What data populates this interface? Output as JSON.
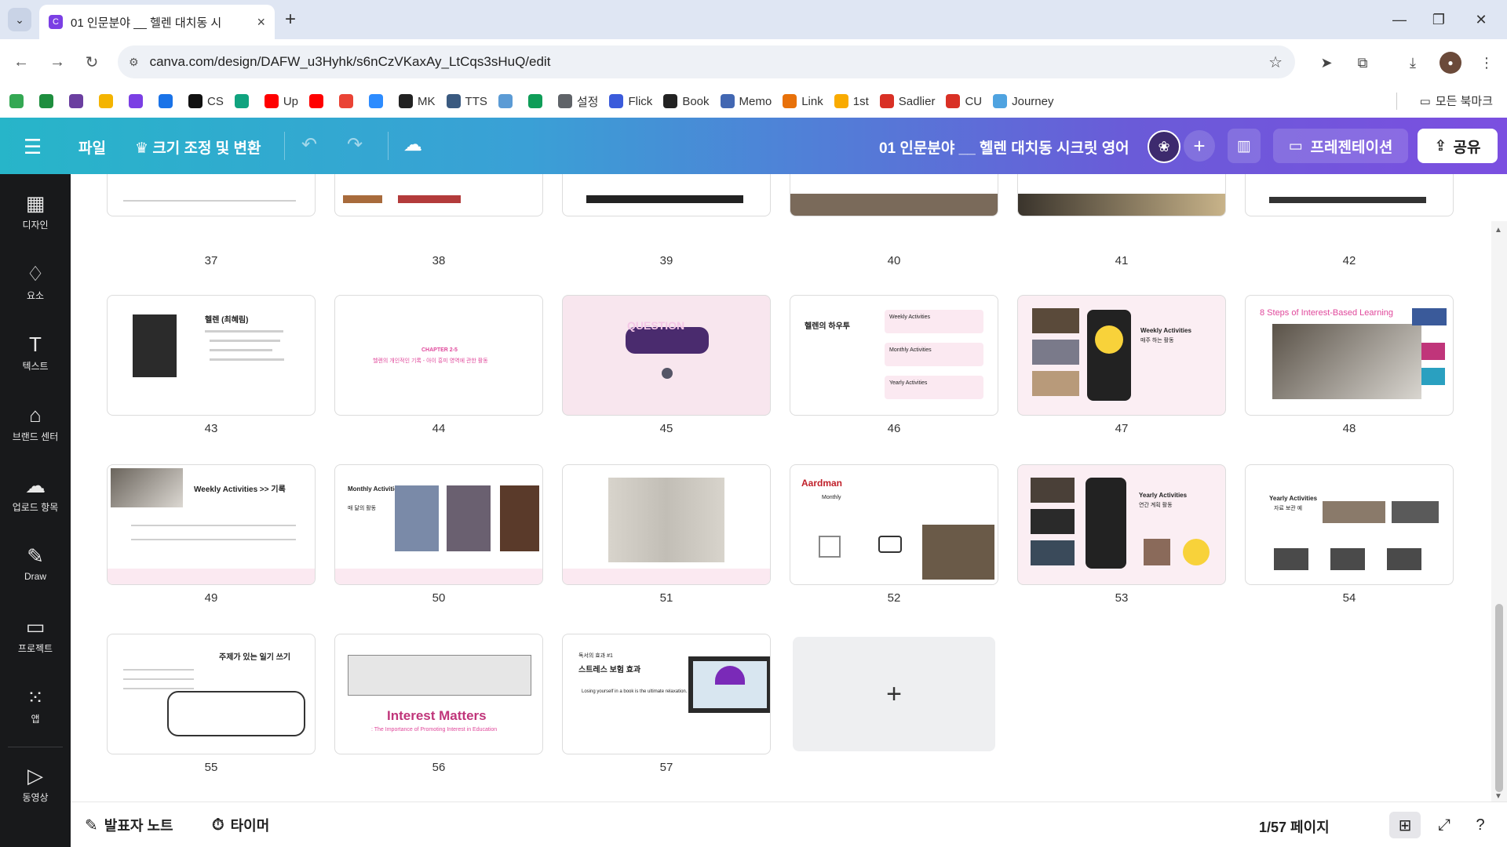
{
  "browser": {
    "tab_title": "01 인문분야 __ 헬렌 대치동 시",
    "url": "canva.com/design/DAFW_u3Hyhk/s6nCzVKaxAy_LtCqs3sHuQ/edit",
    "bookmarks": [
      {
        "label": "",
        "color": "#34a853",
        "icon": "drive-icon"
      },
      {
        "label": "",
        "color": "#1e8e3e",
        "icon": "chat-icon"
      },
      {
        "label": "",
        "color": "#6b3fa0",
        "icon": "podcast-icon"
      },
      {
        "label": "",
        "color": "#f4b400",
        "icon": "classroom-icon"
      },
      {
        "label": "",
        "color": "#7b3fe4",
        "icon": "twitch-icon"
      },
      {
        "label": "",
        "color": "#1a73e8",
        "icon": "chrome-icon"
      },
      {
        "label": "CS",
        "color": "#111111",
        "icon": "ch-icon"
      },
      {
        "label": "",
        "color": "#10a37f",
        "icon": "openai-icon"
      },
      {
        "label": "Up",
        "color": "#ff0000",
        "icon": "youtube-icon"
      },
      {
        "label": "",
        "color": "#ff0000",
        "icon": "youtube-icon"
      },
      {
        "label": "",
        "color": "#ea4335",
        "icon": "gmail-icon"
      },
      {
        "label": "",
        "color": "#2d8cff",
        "icon": "zoom-icon"
      },
      {
        "label": "MK",
        "color": "#222222",
        "icon": "mk-icon"
      },
      {
        "label": "TTS",
        "color": "#3a5a80",
        "icon": "tts-icon"
      },
      {
        "label": "",
        "color": "#5b9bd5",
        "icon": "deepl-icon"
      },
      {
        "label": "",
        "color": "#0f9d58",
        "icon": "sparkle-icon"
      },
      {
        "label": "설정",
        "color": "#5f6368",
        "icon": "gear-icon"
      },
      {
        "label": "Flick",
        "color": "#3b5bdb",
        "icon": "flick-icon"
      },
      {
        "label": "Book",
        "color": "#222222",
        "icon": "amazon-icon"
      },
      {
        "label": "Memo",
        "color": "#4267b2",
        "icon": "memo-icon"
      },
      {
        "label": "Link",
        "color": "#e8710a",
        "icon": "link-icon"
      },
      {
        "label": "1st",
        "color": "#f9ab00",
        "icon": "runner-icon"
      },
      {
        "label": "Sadlier",
        "color": "#d93025",
        "icon": "sadlier-icon"
      },
      {
        "label": "CU",
        "color": "#d93025",
        "icon": "cu-icon"
      },
      {
        "label": "Journey",
        "color": "#4fa3e0",
        "icon": "journey-icon"
      }
    ],
    "all_bookmarks_label": "모든 북마크"
  },
  "header": {
    "file_label": "파일",
    "resize_label": "크기 조정 및 변환",
    "doc_title": "01 인문분야 __ 헬렌 대치동 시크릿 영어",
    "present_label": "프레젠테이션",
    "share_label": "공유"
  },
  "sidebar": {
    "items": [
      {
        "label": "디자인",
        "icon": "layout-icon"
      },
      {
        "label": "요소",
        "icon": "shapes-icon"
      },
      {
        "label": "텍스트",
        "icon": "text-icon"
      },
      {
        "label": "브랜드 센터",
        "icon": "brand-icon"
      },
      {
        "label": "업로드 항목",
        "icon": "upload-icon"
      },
      {
        "label": "Draw",
        "icon": "draw-icon"
      },
      {
        "label": "프로젝트",
        "icon": "folder-icon"
      },
      {
        "label": "앱",
        "icon": "apps-icon"
      },
      {
        "label": "동영상",
        "icon": "video-icon"
      }
    ]
  },
  "slides": {
    "top_row": [
      "37",
      "38",
      "39",
      "40",
      "41",
      "42"
    ],
    "row2": [
      "43",
      "44",
      "45",
      "46",
      "47",
      "48"
    ],
    "row3": [
      "49",
      "50",
      "51",
      "52",
      "53",
      "54"
    ],
    "row4": [
      "55",
      "56",
      "57"
    ],
    "s43": {
      "title": "헬렌 (최혜림)"
    },
    "s44": {
      "title": "CHAPTER 2-5",
      "sub": "헬렌의 개인적인 기록 - 아이 흥미 영역에 관한 활동"
    },
    "s45": {
      "title": "QUESTION"
    },
    "s46": {
      "title": "헬렌의 하우투",
      "items": [
        "Weekly Activities",
        "Monthly Activities",
        "Yearly Activities"
      ]
    },
    "s47": {
      "title": "Weekly Activities",
      "sub": "매주 하는 활동"
    },
    "s48": {
      "title": "8 Steps of Interest-Based Learning"
    },
    "s49": {
      "title": "Weekly Activities >> 기록"
    },
    "s50": {
      "title": "Monthly Activities",
      "sub": "매 달의 활동"
    },
    "s52": {
      "title": "Aardman",
      "sub": "Monthly"
    },
    "s53": {
      "title": "Yearly Activities",
      "sub": "연간 계획 활동"
    },
    "s54": {
      "title": "Yearly Activities",
      "sub": "자료 보관 예"
    },
    "s55": {
      "title": "주제가 있는 일기 쓰기"
    },
    "s56": {
      "title": "Interest Matters",
      "sub": ": The Importance of Promoting Interest in Education"
    },
    "s57": {
      "title": "스트레스 보험 효과",
      "sub": "독서의 효과 #1",
      "quote": "Losing yourself in a book is the ultimate relaxation."
    }
  },
  "footer": {
    "notes_label": "발표자 노트",
    "timer_label": "타이머",
    "page_indicator": "1/57 페이지"
  }
}
